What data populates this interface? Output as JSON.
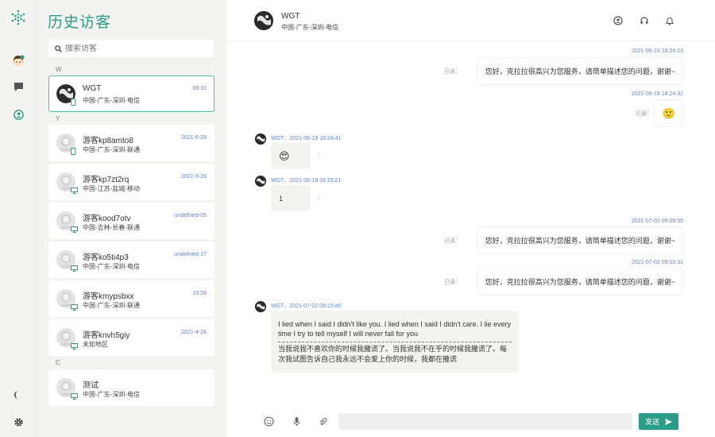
{
  "colors": {
    "accent": "#2a9d86",
    "time_blue": "#5a84c9",
    "panel_bg": "#f3f4f2"
  },
  "rail": {
    "icons": [
      "logo-icon",
      "visitor-avatar-icon",
      "chat-icon",
      "user-circle-icon",
      "moon-icon",
      "gear-icon"
    ]
  },
  "panel": {
    "title": "历史访客",
    "search_placeholder": "搜索访客",
    "groups": [
      "W",
      "Y",
      "C"
    ],
    "visitors": [
      {
        "name": "WGT",
        "location": "中国-广东-深圳-电信",
        "time": "09:10",
        "device": "mobile",
        "active": true
      },
      {
        "name": "游客kp8amto8",
        "location": "中国-广东-深圳-联通",
        "time": "2021-6-28",
        "device": "mobile",
        "active": false
      },
      {
        "name": "游客kp7zt2rq",
        "location": "中国-江苏-盐城-移动",
        "time": "2021-6-28",
        "device": "desktop",
        "active": false
      },
      {
        "name": "游客kood7otv",
        "location": "中国-吉林-长春-联通",
        "time": "undefined-05",
        "device": "desktop",
        "active": false
      },
      {
        "name": "游客ko5ti4p3",
        "location": "中国-广东-深圳-电信",
        "time": "undefined-17",
        "device": "desktop",
        "active": false
      },
      {
        "name": "游客kmypsbxx",
        "location": "中国-广东-深圳-联通",
        "time": "19:59",
        "device": "desktop",
        "active": false
      },
      {
        "name": "游客knvh5giy",
        "location": "未知地区",
        "time": "2021-4-24",
        "device": "desktop",
        "active": false
      },
      {
        "name": "测试",
        "location": "中国-广东-深圳-电信",
        "time": "",
        "device": "desktop",
        "active": false
      }
    ]
  },
  "chat": {
    "header": {
      "name": "WGT",
      "location": "中国-广东-深圳-电信"
    },
    "messages": [
      {
        "dir": "out",
        "time": "2021-06-19 18:24:23",
        "text": "您好，克拉拉很高兴为您服务，请简单描述您的问题，谢谢~",
        "status": "已读"
      },
      {
        "dir": "out",
        "time": "2021-06-19 18:24:32",
        "text": "🙂",
        "status": "已读"
      },
      {
        "dir": "in",
        "meta": "WGT、2021-06-19 18:24:41",
        "text": "😍"
      },
      {
        "dir": "in",
        "meta": "WGT、2021-06-19 18:25:21",
        "text": "1"
      },
      {
        "dir": "out",
        "time": "2021-07-02 09:09:55",
        "text": "您好，克拉拉很高兴为您服务，请简单描述您的问题，谢谢~",
        "status": "已读"
      },
      {
        "dir": "out",
        "time": "2021-07-02 09:10:31",
        "text": "您好，克拉拉很高兴为您服务，请简单描述您的问题，谢谢~",
        "status": "已读"
      },
      {
        "dir": "in",
        "meta": "WGT、2021-07-02 09:10:40",
        "text_en": "I lied when I said I didn't like you. I lied when I said I didn't care. I lie every time I try to tell myself I will never fall for you",
        "text_zh": "当我说我不喜欢你的时候我撒谎了。当我说我不在乎的时候我撒谎了。每次我试图告诉自己我永远不会爱上你的时候，我都在撒谎"
      }
    ]
  },
  "composer": {
    "placeholder": "",
    "send_label": "发送"
  }
}
